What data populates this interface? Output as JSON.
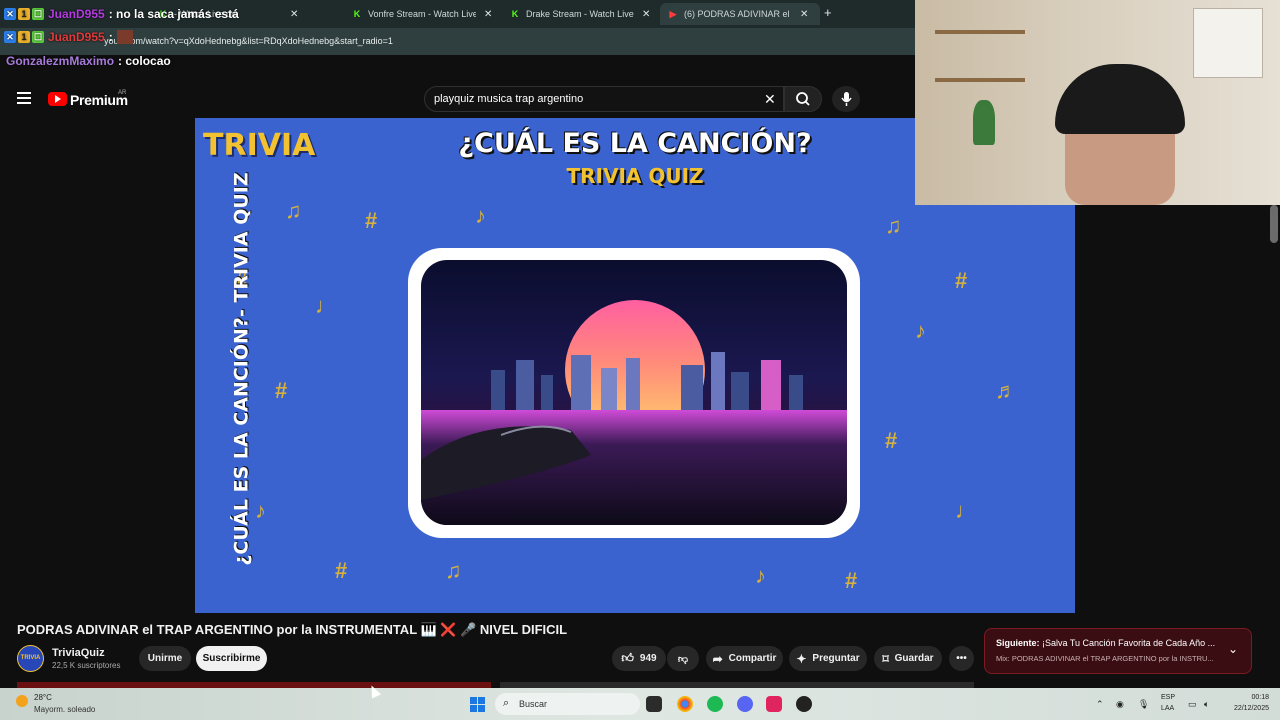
{
  "browser": {
    "tabs": [
      {
        "title": "- Watch Live on",
        "icon": "kick-icon"
      },
      {
        "title": "Vonfre Stream - Watch Live on",
        "icon": "kick-icon"
      },
      {
        "title": "Drake Stream - Watch Live on",
        "icon": "kick-icon"
      },
      {
        "title": "(6) PODRAS ADIVINAR el TRAP",
        "icon": "youtube-icon"
      }
    ],
    "url": "you...com/watch?v=qXdoHednebg&list=RDqXdoHednebg&start_radio=1"
  },
  "chat": [
    {
      "user": "JuanD955",
      "message": ": no la saca jamás está",
      "user_color": "#b33adf"
    },
    {
      "user": "JuanD955",
      "message": ":",
      "user_color": "#e03a3a"
    },
    {
      "user": "GonzalezmMaximo",
      "message": ": colocao",
      "user_color": "#a77bd9"
    }
  ],
  "masthead": {
    "brand": "Premium",
    "region": "AR",
    "search_query": "playquiz musica trap argentino"
  },
  "video": {
    "logo": "TRIVIA",
    "heading": "¿CUÁL ES LA CANCIÓN?",
    "subheading": "TRIVIA QUIZ",
    "side_text": "¿CUÁL ES LA CANCIÓN?- TRIVIA QUIZ",
    "title": "PODRAS ADIVINAR el TRAP ARGENTINO por la INSTRUMENTAL 🎹 ❌ 🎤 NIVEL DIFICIL"
  },
  "channel": {
    "name": "TriviaQuiz",
    "subscribers": "22,5 K suscriptores",
    "avatar_text": "TRIVIA",
    "join_label": "Unirme",
    "subscribe_label": "Suscribirme"
  },
  "actions": {
    "likes": "949",
    "share_label": "Compartir",
    "ask_label": "Preguntar",
    "save_label": "Guardar"
  },
  "up_next": {
    "label": "Siguiente:",
    "title": "¡Salva Tu Canción Favorita de Cada Año ...",
    "mix": "Mix: PODRAS ADIVINAR el TRAP ARGENTINO por la INSTRU..."
  },
  "taskbar": {
    "temperature": "28°C",
    "condition": "Mayorm. soleado",
    "search_placeholder": "Buscar",
    "lang_top": "ESP",
    "lang_bottom": "LAA",
    "time": "00:18",
    "date": "22/12/2025"
  },
  "colors": {
    "accent": "#ff0000",
    "video_bg": "#3a63cf",
    "trivia_yellow": "#f2c230",
    "upnext_bg": "#3a0d12"
  }
}
